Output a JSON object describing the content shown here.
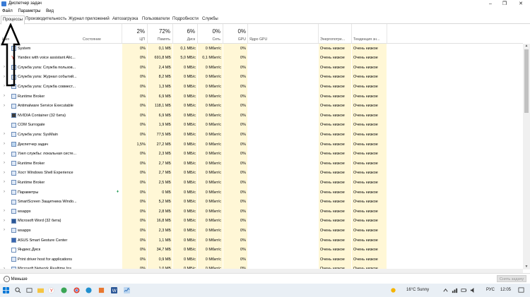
{
  "window": {
    "title": "Диспетчер задач",
    "minimize": "–",
    "maximize": "❐",
    "close": "✕"
  },
  "menu": [
    "Файл",
    "Параметры",
    "Вид"
  ],
  "tabs": [
    "Процессы",
    "Производительность",
    "Журнал приложений",
    "Автозагрузка",
    "Пользователи",
    "Подробности",
    "Службы"
  ],
  "header": {
    "name": "Имя",
    "status": "Состояние",
    "cpu_pct": "2%",
    "cpu": "ЦП",
    "mem_pct": "72%",
    "mem": "Память",
    "disk_pct": "6%",
    "disk": "Диск",
    "net_pct": "0%",
    "net": "Сеть",
    "gpu_pct": "0%",
    "gpu": "GPU",
    "gpu_core": "Ядро GPU",
    "energy": "Энергопотре...",
    "energy_trend": "Тенденция эн..."
  },
  "rows": [
    {
      "name": "System",
      "cpu": "0%",
      "mem": "0,1 МБ",
      "disk": "0,1 МБ/с",
      "net": "0 Мбит/с",
      "gpu": "0%",
      "energy": "Очень низкое",
      "trend": "Очень низкое",
      "exp": "",
      "icon_color": "#dfe9f7"
    },
    {
      "name": "Yandex with voice assistant Alic...",
      "cpu": "0%",
      "mem": "691,8 МБ",
      "disk": "5,0 МБ/с",
      "net": "0,1 Мбит/с",
      "gpu": "0%",
      "energy": "Очень низкое",
      "trend": "Очень низкое",
      "exp": "",
      "icon_color": "#ffffff"
    },
    {
      "name": "Служба узла: Служба пользов...",
      "cpu": "0%",
      "mem": "2,4 МБ",
      "disk": "0 МБ/с",
      "net": "0 Мбит/с",
      "gpu": "0%",
      "energy": "Очень низкое",
      "trend": "Очень низкое",
      "exp": "›",
      "icon_color": "#dfe9f7"
    },
    {
      "name": "Служба узла: Журнал событий...",
      "cpu": "0%",
      "mem": "8,2 МБ",
      "disk": "0 МБ/с",
      "net": "0 Мбит/с",
      "gpu": "0%",
      "energy": "Очень низкое",
      "trend": "Очень низкое",
      "exp": "›",
      "icon_color": "#dfe9f7"
    },
    {
      "name": "Служба узла: Служба совмест...",
      "cpu": "0%",
      "mem": "1,3 МБ",
      "disk": "0 МБ/с",
      "net": "0 Мбит/с",
      "gpu": "0%",
      "energy": "Очень низкое",
      "trend": "Очень низкое",
      "exp": "›",
      "icon_color": "#dfe9f7"
    },
    {
      "name": "Runtime Broker",
      "cpu": "0%",
      "mem": "6,9 МБ",
      "disk": "0 МБ/с",
      "net": "0 Мбит/с",
      "gpu": "0%",
      "energy": "Очень низкое",
      "trend": "Очень низкое",
      "exp": "›",
      "icon_color": "#dfe9f7"
    },
    {
      "name": "Antimalware Service Executable",
      "cpu": "0%",
      "mem": "118,1 МБ",
      "disk": "0 МБ/с",
      "net": "0 Мбит/с",
      "gpu": "0%",
      "energy": "Очень низкое",
      "trend": "Очень низкое",
      "exp": "›",
      "icon_color": "#dfe9f7"
    },
    {
      "name": "NVIDIA Container (32 бита)",
      "cpu": "0%",
      "mem": "6,9 МБ",
      "disk": "0 МБ/с",
      "net": "0 Мбит/с",
      "gpu": "0%",
      "energy": "Очень низкое",
      "trend": "Очень низкое",
      "exp": "",
      "icon_color": "#3c3c3c"
    },
    {
      "name": "COM Surrogate",
      "cpu": "0%",
      "mem": "1,9 МБ",
      "disk": "0 МБ/с",
      "net": "0 Мбит/с",
      "gpu": "0%",
      "energy": "Очень низкое",
      "trend": "Очень низкое",
      "exp": "",
      "icon_color": "#dfe9f7"
    },
    {
      "name": "Служба узла: SysMain",
      "cpu": "0%",
      "mem": "77,5 МБ",
      "disk": "0 МБ/с",
      "net": "0 Мбит/с",
      "gpu": "0%",
      "energy": "Очень низкое",
      "trend": "Очень низкое",
      "exp": "›",
      "icon_color": "#dfe9f7"
    },
    {
      "name": "Диспетчер задач",
      "cpu": "1,5%",
      "mem": "27,2 МБ",
      "disk": "0 МБ/с",
      "net": "0 Мбит/с",
      "gpu": "0%",
      "energy": "Очень низкое",
      "trend": "Очень низкое",
      "exp": "›",
      "icon_color": "#bcd6f0"
    },
    {
      "name": "Узел службы: локальная систе...",
      "cpu": "0%",
      "mem": "2,3 МБ",
      "disk": "0 МБ/с",
      "net": "0 Мбит/с",
      "gpu": "0%",
      "energy": "Очень низкое",
      "trend": "Очень низкое",
      "exp": "›",
      "icon_color": "#dfe9f7"
    },
    {
      "name": "Runtime Broker",
      "cpu": "0%",
      "mem": "2,7 МБ",
      "disk": "0 МБ/с",
      "net": "0 Мбит/с",
      "gpu": "0%",
      "energy": "Очень низкое",
      "trend": "Очень низкое",
      "exp": "›",
      "icon_color": "#dfe9f7"
    },
    {
      "name": "Хост Windows Shell Experience",
      "cpu": "0%",
      "mem": "2,7 МБ",
      "disk": "0 МБ/с",
      "net": "0 Мбит/с",
      "gpu": "0%",
      "energy": "Очень низкое",
      "trend": "Очень низкое",
      "exp": "›",
      "icon_color": "#dfe9f7"
    },
    {
      "name": "Runtime Broker",
      "cpu": "0%",
      "mem": "2,5 МБ",
      "disk": "0 МБ/с",
      "net": "0 Мбит/с",
      "gpu": "0%",
      "energy": "Очень низкое",
      "trend": "Очень низкое",
      "exp": "›",
      "icon_color": "#dfe9f7"
    },
    {
      "name": "Параметры",
      "cpu": "0%",
      "mem": "0 МБ",
      "disk": "0 МБ/с",
      "net": "0 Мбит/с",
      "gpu": "0%",
      "energy": "Очень низкое",
      "trend": "Очень низкое",
      "exp": "›",
      "icon_color": "#dfe9f7",
      "leaf": "♦"
    },
    {
      "name": "SmartScreen Защитника Windo...",
      "cpu": "0%",
      "mem": "5,2 МБ",
      "disk": "0 МБ/с",
      "net": "0 Мбит/с",
      "gpu": "0%",
      "energy": "Очень низкое",
      "trend": "Очень низкое",
      "exp": "",
      "icon_color": "#dfe9f7"
    },
    {
      "name": "wsappx",
      "cpu": "0%",
      "mem": "2,8 МБ",
      "disk": "0 МБ/с",
      "net": "0 Мбит/с",
      "gpu": "0%",
      "energy": "Очень низкое",
      "trend": "Очень низкое",
      "exp": "›",
      "icon_color": "#dfe9f7"
    },
    {
      "name": "Microsoft Word (32 бита)",
      "cpu": "0%",
      "mem": "16,8 МБ",
      "disk": "0 МБ/с",
      "net": "0 Мбит/с",
      "gpu": "0%",
      "energy": "Очень низкое",
      "trend": "Очень низкое",
      "exp": "›",
      "icon_color": "#2b5797"
    },
    {
      "name": "wsappx",
      "cpu": "0%",
      "mem": "2,3 МБ",
      "disk": "0 МБ/с",
      "net": "0 Мбит/с",
      "gpu": "0%",
      "energy": "Очень низкое",
      "trend": "Очень низкое",
      "exp": "›",
      "icon_color": "#dfe9f7"
    },
    {
      "name": "ASUS Smart Gesture Center",
      "cpu": "0%",
      "mem": "1,1 МБ",
      "disk": "0 МБ/с",
      "net": "0 Мбит/с",
      "gpu": "0%",
      "energy": "Очень низкое",
      "trend": "Очень низкое",
      "exp": "",
      "icon_color": "#3a66b0"
    },
    {
      "name": "Яндекс.Диск",
      "cpu": "0%",
      "mem": "34,7 МБ",
      "disk": "0 МБ/с",
      "net": "0 Мбит/с",
      "gpu": "0%",
      "energy": "Очень низкое",
      "trend": "Очень низкое",
      "exp": "",
      "icon_color": "#ffffff"
    },
    {
      "name": "Print driver host for applications",
      "cpu": "0%",
      "mem": "0,9 МБ",
      "disk": "0 МБ/с",
      "net": "0 Мбит/с",
      "gpu": "0%",
      "energy": "Очень низкое",
      "trend": "Очень низкое",
      "exp": "",
      "icon_color": "#dfe9f7"
    },
    {
      "name": "Microsoft Network Realtime Ins...",
      "cpu": "0%",
      "mem": "1,0 МБ",
      "disk": "0 МБ/с",
      "net": "0 Мбит/с",
      "gpu": "0%",
      "energy": "Очень низкое",
      "trend": "Очень низкое",
      "exp": "›",
      "icon_color": "#dfe9f7"
    }
  ],
  "footer": {
    "less": "Меньше",
    "end_task": "Снять задачу"
  },
  "taskbar": {
    "weather": "16°C  Sunny",
    "lang": "РУС",
    "time": "12:05"
  },
  "colors": {
    "accent": "#0078d7",
    "heat": "#fff3c4",
    "heat_strong": "#ffe7a0"
  }
}
